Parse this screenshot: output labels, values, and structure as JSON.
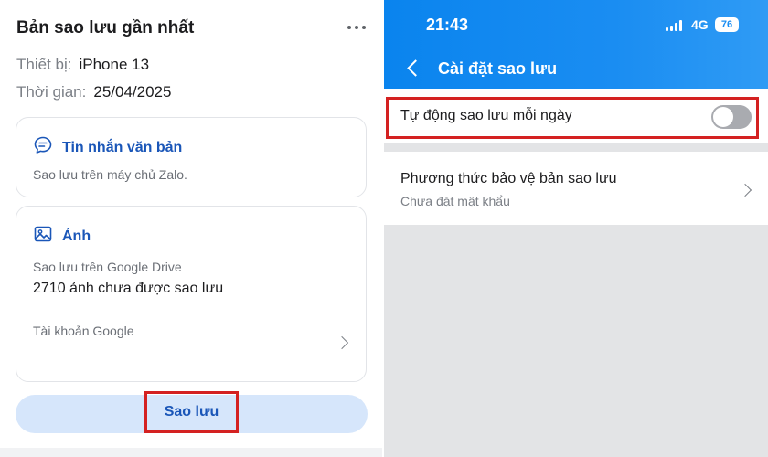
{
  "left": {
    "title": "Bản sao lưu gần nhất",
    "device_key": "Thiết bị:",
    "device_value": "iPhone 13",
    "time_key": "Thời gian:",
    "time_value": "25/04/2025",
    "messages_card": {
      "icon": "chat-bubble-icon",
      "label": "Tin nhắn văn bản",
      "sub": "Sao lưu trên máy chủ Zalo."
    },
    "photos_card": {
      "icon": "image-icon",
      "label": "Ảnh",
      "sub": "Sao lưu trên Google Drive",
      "count_text": "2710 ảnh chưa được sao lưu",
      "account_label": "Tài khoản Google"
    },
    "backup_button_label": "Sao lưu"
  },
  "right": {
    "status_time": "21:43",
    "network": "4G",
    "battery": "76",
    "nav_title": "Cài đặt sao lưu",
    "auto_backup_label": "Tự động sao lưu mỗi ngày",
    "auto_backup_enabled": false,
    "protect_title": "Phương thức bảo vệ bản sao lưu",
    "protect_sub": "Chưa đặt mật khẩu"
  },
  "colors": {
    "accent_blue": "#1a56b8",
    "header_blue": "#0a84ee",
    "highlight_red": "#d42121",
    "button_bg": "#d6e6fb"
  }
}
